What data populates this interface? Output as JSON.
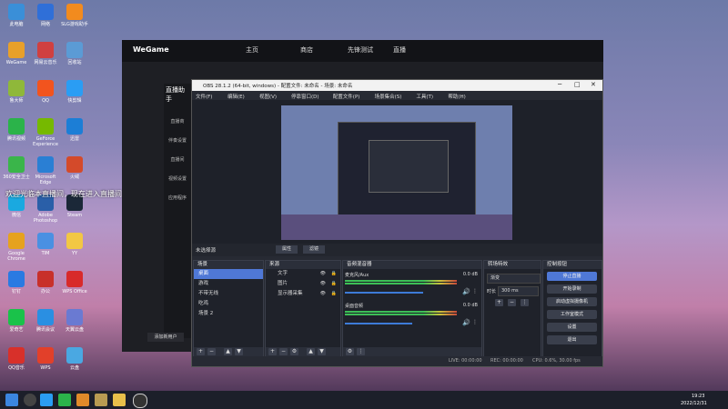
{
  "desktop": {
    "icons": [
      "此电脑",
      "网络",
      "SLG游戏助手",
      "WeGame",
      "网易云音乐",
      "回收站",
      "鲁大师",
      "QQ",
      "快剪辑",
      "腾讯视频",
      "GeForce Experience",
      "迅雷",
      "360安全卫士",
      "Microsoft Edge",
      "火绒",
      "微信",
      "Adobe Photoshop",
      "Steam",
      "Google Chrome",
      "TIM",
      "YY",
      "钉钉",
      "办公",
      "WPS Office",
      "爱奇艺",
      "腾讯会议",
      "天翼云盘",
      "QQ音乐",
      "WPS",
      "云盘"
    ],
    "overlay_text": "欢迎光临本直播间，现在进入直播间",
    "taskbar_time": "19:23",
    "taskbar_date": "2022/12/31"
  },
  "wegame": {
    "logo": "WeGame",
    "tabs": [
      "主页",
      "商店",
      "先锋测试",
      "直播"
    ],
    "sidebar": [
      "直播商",
      "伴奏设置",
      "直播间",
      "视频设置",
      "应用程序"
    ],
    "sidebar_label": "直播助手",
    "footer_btn": "添加新用户"
  },
  "obs": {
    "title": "OBS 28.1.2 (64-bit, windows) - 配置文件: 未命名 - 场景: 未命名",
    "menus": [
      "文件(F)",
      "编辑(E)",
      "视图(V)",
      "停靠窗口(D)",
      "配置文件(P)",
      "场景集合(S)",
      "工具(T)",
      "帮助(H)"
    ],
    "no_source": "未选择源",
    "prop_btn": "属性",
    "filter_btn": "滤镜",
    "scenes": {
      "title": "场景",
      "items": [
        "桌面",
        "游戏",
        "不带无线",
        "吃鸡",
        "场景 2"
      ],
      "selected": 0
    },
    "sources": {
      "title": "来源",
      "items": [
        "文字",
        "图片",
        "显示器采集"
      ]
    },
    "mixer": {
      "title": "音频混音器",
      "channels": [
        {
          "name": "麦克风/Aux",
          "db": "0.0 dB",
          "level": 0.7
        },
        {
          "name": "桌面音频",
          "db": "0.0 dB",
          "level": 0.6
        }
      ],
      "scale": [
        "-60",
        "-55",
        "-50",
        "-45",
        "-40",
        "-35",
        "-30",
        "-25",
        "-20",
        "-15",
        "-10",
        "-5",
        "0"
      ]
    },
    "transitions": {
      "title": "转场特效",
      "type": "渐变",
      "duration_label": "时长",
      "duration": "300 ms"
    },
    "controls": {
      "title": "控制按钮",
      "buttons": [
        "停止直播",
        "开始录制",
        "启动虚拟摄像机",
        "工作室模式",
        "设置",
        "退出"
      ]
    },
    "status": {
      "live": "LIVE: 00:00:00",
      "rec": "REC: 00:00:00",
      "cpu": "CPU: 0.6%, 30.00 fps"
    }
  },
  "colors": {
    "accent": "#4f78d6",
    "obs_bg": "#272a33",
    "dock_bg": "#1f222a"
  }
}
